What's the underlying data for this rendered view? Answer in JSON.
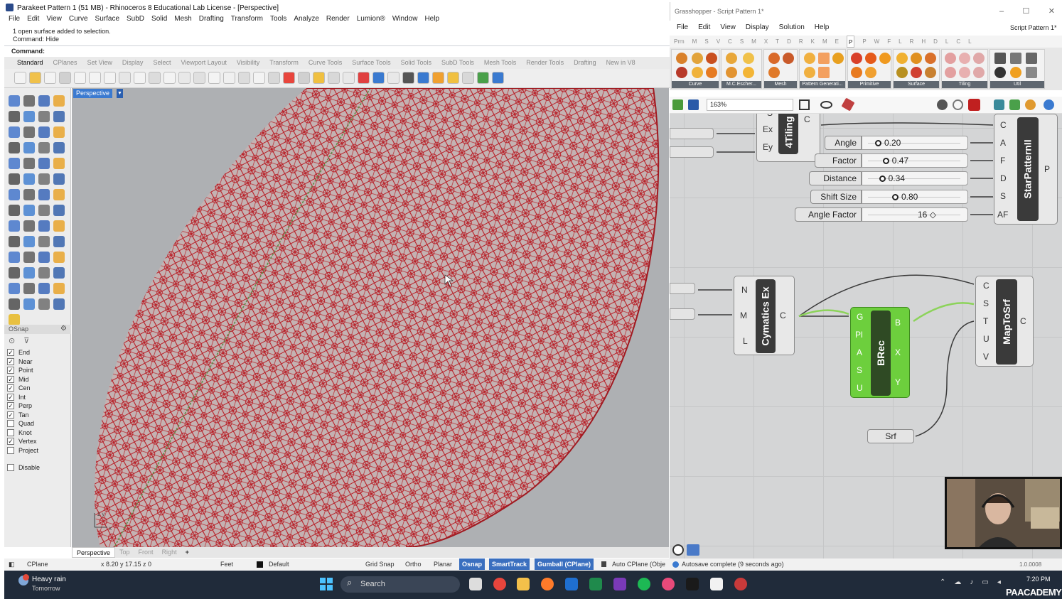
{
  "rhino": {
    "title": "Parakeet Pattern 1 (51 MB) - Rhinoceros 8 Educational Lab License - [Perspective]",
    "menu": [
      "File",
      "Edit",
      "View",
      "Curve",
      "Surface",
      "SubD",
      "Solid",
      "Mesh",
      "Drafting",
      "Transform",
      "Tools",
      "Analyze",
      "Render",
      "Lumion®",
      "Window",
      "Help"
    ],
    "history": [
      "1 open surface added to selection.",
      "Command: Hide"
    ],
    "command_prompt": "Command:",
    "toolbar_tabs": [
      "Standard",
      "CPlanes",
      "Set View",
      "Display",
      "Select",
      "Viewport Layout",
      "Visibility",
      "Transform",
      "Curve Tools",
      "Surface Tools",
      "Solid Tools",
      "SubD Tools",
      "Mesh Tools",
      "Render Tools",
      "Drafting",
      "New in V8"
    ],
    "viewport_label": "Perspective",
    "viewport_tabs": [
      "Perspective",
      "Top",
      "Front",
      "Right",
      "+"
    ],
    "osnap": {
      "header": "OSnap",
      "items": [
        {
          "label": "End",
          "checked": true
        },
        {
          "label": "Near",
          "checked": true
        },
        {
          "label": "Point",
          "checked": true
        },
        {
          "label": "Mid",
          "checked": true
        },
        {
          "label": "Cen",
          "checked": true
        },
        {
          "label": "Int",
          "checked": true
        },
        {
          "label": "Perp",
          "checked": true
        },
        {
          "label": "Tan",
          "checked": true
        },
        {
          "label": "Quad",
          "checked": false
        },
        {
          "label": "Knot",
          "checked": false
        },
        {
          "label": "Vertex",
          "checked": true
        },
        {
          "label": "Project",
          "checked": false
        }
      ],
      "disable": {
        "label": "Disable",
        "checked": false
      }
    },
    "status": {
      "cplane": "CPlane",
      "coords": "x 8.20  y 17.15  z 0",
      "units": "Feet",
      "layer": "Default",
      "grid_snap": "Grid Snap",
      "ortho": "Ortho",
      "planar": "Planar",
      "osnap": "Osnap",
      "smarttrack": "SmartTrack",
      "gumball": "Gumball (CPlane)",
      "auto_cplane": "Auto CPlane (Obje"
    }
  },
  "gh": {
    "title": "Grasshopper - Script Pattern 1*",
    "window_controls": [
      "–",
      "☐",
      "✕"
    ],
    "menu": [
      "File",
      "Edit",
      "View",
      "Display",
      "Solution",
      "Help"
    ],
    "doc_name": "Script Pattern 1*",
    "categories": [
      "Prm",
      "M",
      "S",
      "V",
      "C",
      "S",
      "M",
      "X",
      "T",
      "D",
      "R",
      "K",
      "M",
      "E",
      "P",
      "P",
      "W",
      "F",
      "L",
      "R",
      "H",
      "D",
      "L",
      "C",
      "L"
    ],
    "active_category": "P",
    "ribbon_groups": [
      "Curve",
      "M.C.Escher...",
      "Mesh",
      "Pattern Generati...",
      "Primitive",
      "Surface",
      "Tiling",
      "Util"
    ],
    "zoom": "163%",
    "status": "Autosave complete (9 seconds ago)",
    "version": "1.0.0008",
    "components": {
      "tiling": {
        "name": "4Tiling",
        "inputs": [
          "S",
          "Ex",
          "Ey"
        ],
        "outputs": [
          "C"
        ]
      },
      "starpattern": {
        "name": "StarPatternII",
        "inputs": [
          "C",
          "A",
          "F",
          "D",
          "S",
          "AF"
        ],
        "outputs": [
          "P"
        ]
      },
      "cymatics": {
        "name": "Cymatics Ex",
        "inputs": [
          "N",
          "M",
          "L"
        ],
        "outputs": [
          "C"
        ]
      },
      "brec": {
        "name": "BRec",
        "inputs": [
          "G",
          "Pl",
          "A",
          "S",
          "U"
        ],
        "outputs": [
          "B",
          "X",
          "Y"
        ]
      },
      "maptosrf": {
        "name": "MapToSrf",
        "inputs": [
          "C",
          "S",
          "T",
          "U",
          "V"
        ],
        "outputs": [
          "C"
        ]
      },
      "srf": {
        "name": "Srf"
      }
    },
    "sliders": [
      {
        "label": "Angle",
        "value": "0.20",
        "fraction": 0.2
      },
      {
        "label": "Factor",
        "value": "0.47",
        "fraction": 0.47
      },
      {
        "label": "Distance",
        "value": "0.34",
        "fraction": 0.34
      },
      {
        "label": "Shift Size",
        "value": "0.80",
        "fraction": 0.8
      },
      {
        "label": "Angle Factor",
        "value": "16",
        "fraction": 0.75
      }
    ]
  },
  "taskbar": {
    "weather": "Heavy rain",
    "weather_sub": "Tomorrow",
    "search": "Search",
    "time": "7:20 PM",
    "brand": "PAACADEMY"
  },
  "colors": {
    "pattern": "#c0272d",
    "viewport": "#aeb0b3",
    "gh_canvas": "#d4d5d6",
    "brec_green": "#6dcf3d",
    "selected_blue": "#3a6fbf"
  }
}
